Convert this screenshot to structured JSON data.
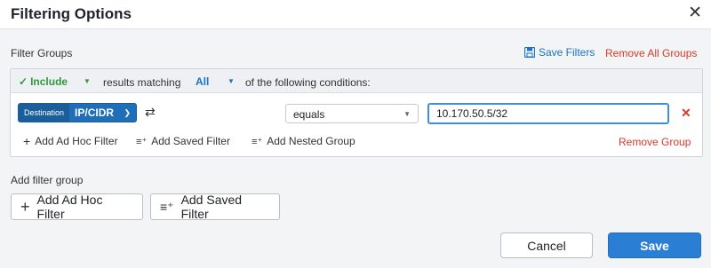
{
  "dialog": {
    "title": "Filtering Options",
    "close_icon": "close-icon"
  },
  "filter_groups": {
    "label": "Filter Groups",
    "save_filters_label": "Save Filters",
    "remove_all_label": "Remove All Groups",
    "group": {
      "include_label": "Include",
      "results_text": "results matching",
      "match_mode": "All",
      "conditions_text": "of the following conditions:",
      "condition": {
        "field_tag": "Destination",
        "field_value": "IP/CIDR",
        "operator": "equals",
        "value": "10.170.50.5/32"
      },
      "add_ad_hoc_label": "Add Ad Hoc Filter",
      "add_saved_label": "Add Saved Filter",
      "add_nested_label": "Add Nested Group",
      "remove_group_label": "Remove Group"
    }
  },
  "add_filter_group": {
    "label": "Add filter group",
    "add_ad_hoc_label": "Add Ad Hoc Filter",
    "add_saved_label": "Add Saved Filter"
  },
  "footer": {
    "cancel_label": "Cancel",
    "save_label": "Save"
  },
  "colors": {
    "accent": "#1a73c7",
    "danger": "#d93a2b",
    "success": "#2e9a3a",
    "primary_button": "#2a7fd4"
  }
}
